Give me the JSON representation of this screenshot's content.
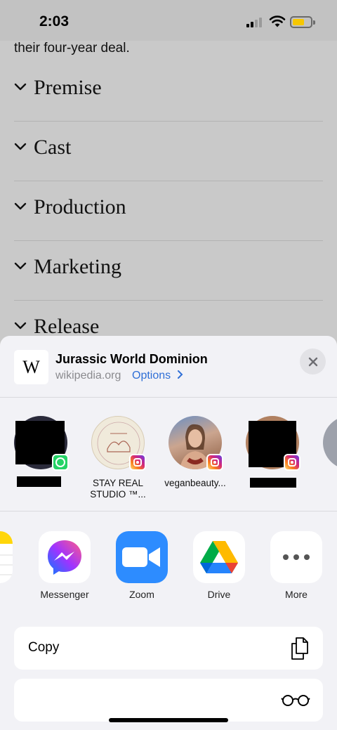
{
  "status_bar": {
    "time": "2:03"
  },
  "article": {
    "snippet": "their four-year deal.",
    "sections": [
      {
        "label": "Premise"
      },
      {
        "label": "Cast"
      },
      {
        "label": "Production"
      },
      {
        "label": "Marketing"
      },
      {
        "label": "Release"
      }
    ]
  },
  "share_sheet": {
    "site_icon_letter": "W",
    "title": "Jurassic World Dominion",
    "domain": "wikipedia.org",
    "options_label": "Options",
    "contacts": [
      {
        "name": "",
        "app": "whatsapp-icon",
        "redacted": true
      },
      {
        "name": "STAY REAL STUDIO ™...",
        "app": "instagram-icon",
        "redacted": false
      },
      {
        "name": "veganbeauty...",
        "app": "instagram-icon",
        "redacted": false
      },
      {
        "name": "",
        "app": "instagram-icon",
        "redacted": true
      }
    ],
    "apps": [
      {
        "label": "Messenger"
      },
      {
        "label": "Zoom"
      },
      {
        "label": "Drive"
      },
      {
        "label": "More"
      }
    ],
    "actions": [
      {
        "label": "Copy",
        "icon": "copy-icon"
      },
      {
        "label": "",
        "icon": "reading-glasses-icon"
      }
    ]
  },
  "colors": {
    "link": "#2f6fd6",
    "sheet_bg": "#f2f2f6",
    "dim_bg": "#c9c9c9"
  }
}
